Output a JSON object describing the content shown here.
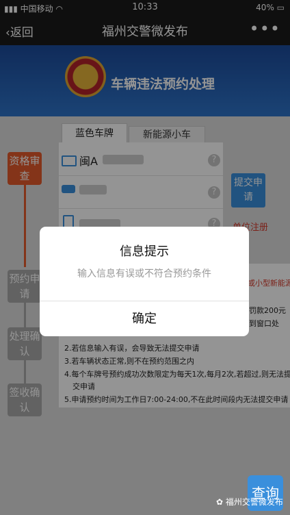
{
  "status_bar": {
    "carrier": "中国移动",
    "time": "10:33",
    "battery": "40%"
  },
  "nav": {
    "back_label": "返回",
    "title": "福州交警微发布",
    "more_label": "•••"
  },
  "banner": {
    "title": "车辆违法预约处理"
  },
  "tabs": [
    {
      "label": "蓝色车牌"
    },
    {
      "label": "新能源小车"
    }
  ],
  "form": {
    "plate_prefix": "闽A",
    "help_glyph": "?"
  },
  "steps": [
    {
      "label": "资格审查"
    },
    {
      "label": "预约申请"
    },
    {
      "label": "处理确认"
    },
    {
      "label": "签收确认"
    }
  ],
  "submit_label": "提交申请",
  "unit_register_label": "单位注册",
  "notice": {
    "right_fragment_1": "或小型新能源",
    "right_fragment_2": "罚款200元",
    "right_fragment_3": "到窗口处",
    "lines": [
      "2.若信息输入有误，会导致无法提交申请",
      "3.若车辆状态正常,则不在预约范围之内",
      "4.每个车牌号预约成功次数限定为每天1次,每月2次,若超过,则无法提",
      "交申请",
      "5.申请预约时间为工作日7:00-24:00,不在此时间段内无法提交申请"
    ]
  },
  "dialog": {
    "title": "信息提示",
    "message": "输入信息有误或不符合预约条件",
    "ok_label": "确定"
  },
  "query_label": "查询",
  "watermark": "福州交警微发布"
}
